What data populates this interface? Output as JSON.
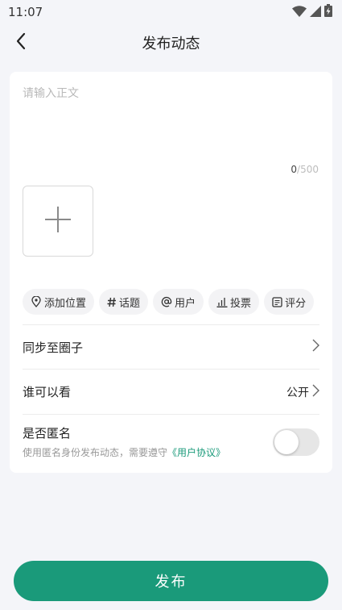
{
  "status_bar": {
    "time": "11:07",
    "icons": [
      "wifi-icon",
      "signal-icon",
      "battery-charging-icon"
    ]
  },
  "header": {
    "title": "发布动态",
    "back_icon": "chevron-left-icon"
  },
  "editor": {
    "placeholder": "请输入正文",
    "value": "",
    "char_count": "0",
    "char_separator": "/",
    "char_max": "500",
    "add_image_icon": "plus-icon"
  },
  "chips": [
    {
      "label": "添加位置",
      "icon": "location-icon"
    },
    {
      "label": "话题",
      "icon": "hashtag-icon"
    },
    {
      "label": "用户",
      "icon": "at-icon"
    },
    {
      "label": "投票",
      "icon": "bar-chart-icon"
    },
    {
      "label": "评分",
      "icon": "rating-icon"
    }
  ],
  "sync_circle": {
    "label": "同步至圈子"
  },
  "visibility": {
    "label": "谁可以看",
    "value": "公开"
  },
  "anonymous": {
    "label": "是否匿名",
    "description": "使用匿名身份发布动态，需要遵守",
    "link": "《用户协议》",
    "enabled": false
  },
  "publish": {
    "label": "发布"
  },
  "colors": {
    "accent": "#1a9a7a",
    "background": "#f4f5f9",
    "card": "#ffffff",
    "chip_background": "#f3f3f5",
    "toggle_off": "#e6e6e6"
  }
}
